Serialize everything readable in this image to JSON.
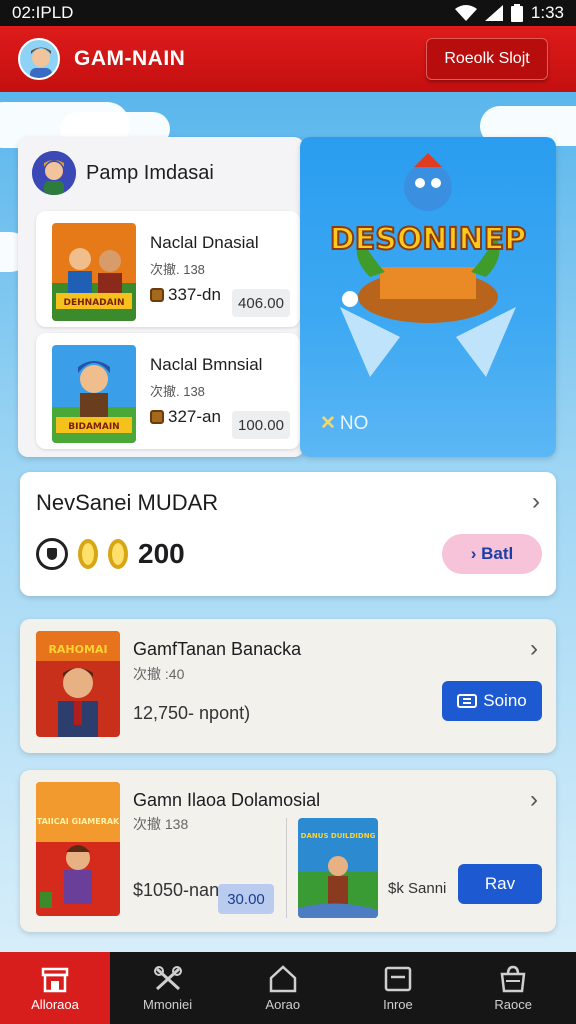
{
  "status_bar": {
    "time": "02:IPLD",
    "clock": "1:33"
  },
  "app_bar": {
    "title": "GAM-NAIN",
    "action_label": "Roeolk Slojt"
  },
  "promo": {
    "title": "Pamp Imdasai",
    "items": [
      {
        "title": "Naclal Dnasial",
        "sub": "次撤. 138",
        "coins": "337-dn",
        "price": "406.00",
        "thumb_text": "DEHNADAIN"
      },
      {
        "title": "Naclal Bmnsial",
        "sub": "次撤. 138",
        "coins": "327-an",
        "price": "100.00",
        "thumb_text": "BIDAMAIN"
      }
    ]
  },
  "hero": {
    "art_text": "DESONINEP",
    "caption_x": "✕",
    "caption": "NO"
  },
  "reward": {
    "title": "NevSanei MUDAR",
    "value": "200",
    "button_label": "› Batl"
  },
  "list": [
    {
      "title": "GamfTanan Banacka",
      "sub": "次撤 :40",
      "value": "12,750- npont)",
      "button_label": "Soino",
      "thumb_text": "RAHOMAI"
    },
    {
      "title": "Gamn Ilaoa Dolamosial",
      "sub": "次撤 138",
      "value": "$1050-nan",
      "price": "30.00",
      "extra_label": "$k Sanni",
      "button_label": "Rav",
      "thumb_text": "TAIICAI GIAMERAK",
      "thumb2_text": "DANUS DUILDIDNG"
    }
  ],
  "nav": [
    {
      "label": "Alloraoa",
      "icon": "store-icon",
      "active": true
    },
    {
      "label": "Mmoniei",
      "icon": "tools-icon",
      "active": false
    },
    {
      "label": "Aorao",
      "icon": "home-icon",
      "active": false
    },
    {
      "label": "Inroe",
      "icon": "inbox-icon",
      "active": false
    },
    {
      "label": "Raoce",
      "icon": "bag-icon",
      "active": false
    }
  ],
  "colors": {
    "brand_red": "#d81d1d",
    "primary_blue": "#1d5ad2",
    "sky": "#6fc3ee"
  }
}
